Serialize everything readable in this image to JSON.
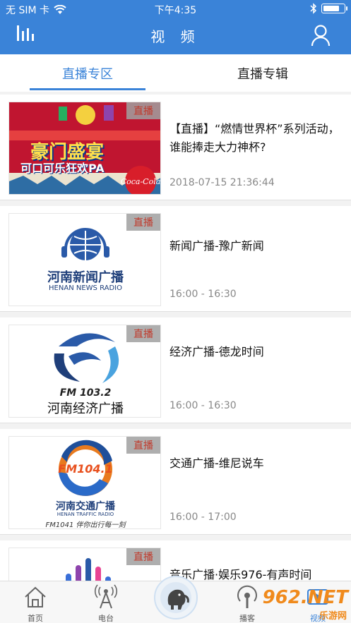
{
  "status_bar": {
    "carrier": "无 SIM 卡",
    "time": "下午4:35"
  },
  "nav": {
    "title": "视 频",
    "left_icon": "stats-icon",
    "right_icon": "user-icon"
  },
  "tabs": [
    {
      "label": "直播专区",
      "active": true
    },
    {
      "label": "直播专辑",
      "active": false
    }
  ],
  "items": [
    {
      "badge": "直播",
      "title": "【直播】“燃情世界杯”系列活动，谁能捧走大力神杯?",
      "meta": "2018-07-15 21:36:44",
      "thumb_text": "豪门盛宴",
      "thumb_sub": "可口可乐狂欢PA",
      "thumb_brand": "Coca-Cola"
    },
    {
      "badge": "直播",
      "title": "新闻广播-豫广新闻",
      "meta": "16:00 - 16:30",
      "logo_cn": "河南新闻广播",
      "logo_en": "HENAN NEWS RADIO"
    },
    {
      "badge": "直播",
      "title": "经济广播-德龙时间",
      "meta": "16:00 - 16:30",
      "logo_fm": "FM 103.2",
      "logo_cn": "河南经济广播"
    },
    {
      "badge": "直播",
      "title": "交通广播-维尼说车",
      "meta": "16:00 - 17:00",
      "logo_fm": "FM104.1",
      "logo_cn": "河南交通广播",
      "logo_en": "HENAN TRAFFIC RADIO",
      "logo_slogan": "FM1041 伴你出行每一刻"
    },
    {
      "badge": "直播",
      "title": "音乐广播·娱乐976-有声时间",
      "meta": ""
    }
  ],
  "tabbar": [
    {
      "label": "首页",
      "icon": "home-icon"
    },
    {
      "label": "电台",
      "icon": "radio-tower-icon"
    },
    {
      "label": "",
      "icon": "elephant-icon"
    },
    {
      "label": "播客",
      "icon": "podcast-icon"
    },
    {
      "label": "视频",
      "icon": "video-icon"
    }
  ],
  "watermark": {
    "brand": "962.NET",
    "site": "乐游网"
  },
  "colors": {
    "accent": "#3a83d8",
    "badge_text": "#c0392b",
    "coca_red": "#d81e2a"
  }
}
